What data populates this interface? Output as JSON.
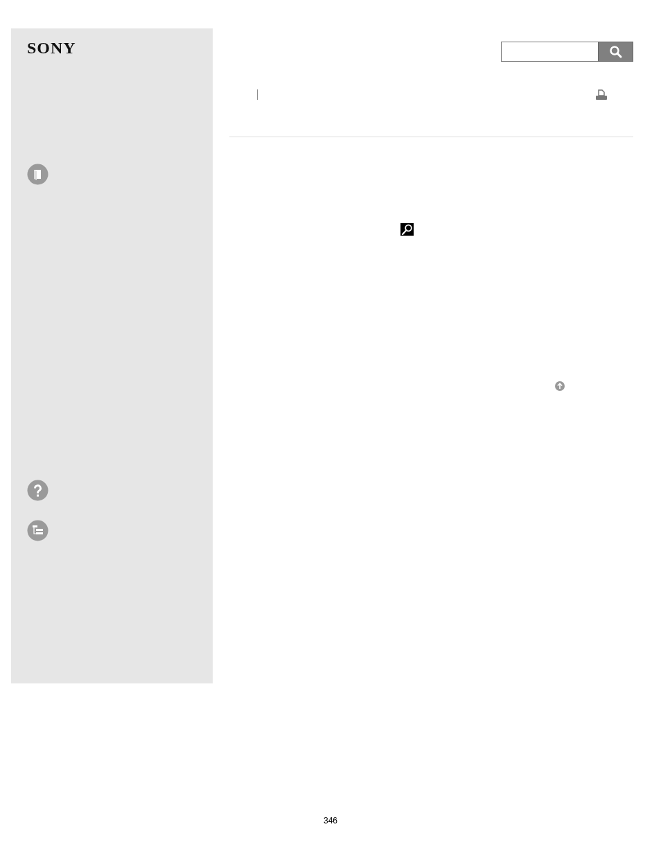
{
  "logo": "SONY",
  "page_number": "346"
}
